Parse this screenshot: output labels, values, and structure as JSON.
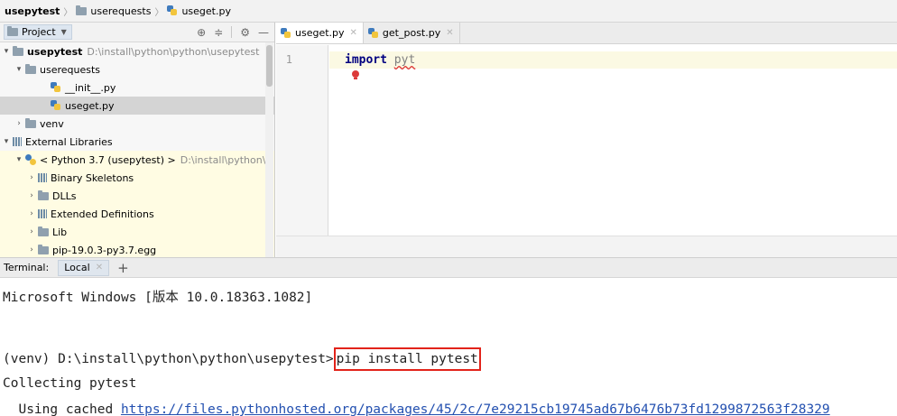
{
  "breadcrumb": [
    "usepytest",
    "userequests",
    "useget.py"
  ],
  "project_panel": {
    "title": "Project",
    "tree": [
      {
        "label": "usepytest",
        "path": "D:\\install\\python\\python\\usepytest"
      },
      {
        "label": "userequests"
      },
      {
        "label": "__init__.py"
      },
      {
        "label": "useget.py"
      },
      {
        "label": "venv"
      },
      {
        "label": "External Libraries"
      },
      {
        "label": "< Python 3.7 (usepytest) >",
        "path": "D:\\install\\python\\p"
      },
      {
        "label": "Binary Skeletons"
      },
      {
        "label": "DLLs"
      },
      {
        "label": "Extended Definitions"
      },
      {
        "label": "Lib"
      },
      {
        "label": "pip-19.0.3-py3.7.egg"
      }
    ]
  },
  "editor": {
    "tabs": [
      "useget.py",
      "get_post.py"
    ],
    "line_number": "1",
    "keyword": "import",
    "module": "pyt"
  },
  "terminal": {
    "label": "Terminal:",
    "tab": "Local",
    "lines": {
      "version": "Microsoft Windows [版本 10.0.18363.1082]",
      "prompt": "(venv) D:\\install\\python\\python\\usepytest>",
      "command": "pip install pytest",
      "collecting": "Collecting pytest",
      "using": "  Using cached ",
      "url": "https://files.pythonhosted.org/packages/45/2c/7e29215cb19745ad67b6476b73fd1299872563f28329"
    }
  }
}
